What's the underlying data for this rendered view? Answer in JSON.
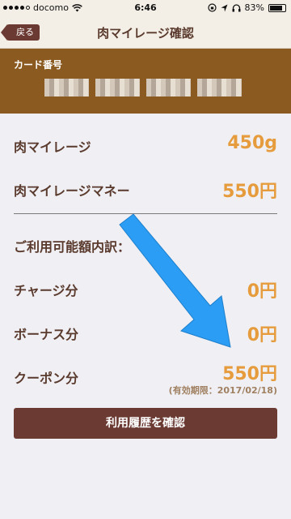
{
  "status_bar": {
    "carrier": "docomo",
    "time": "6:46",
    "battery": "83%",
    "battery_level": 0.83,
    "signal_bars": 4,
    "signal_total": 5
  },
  "nav": {
    "back_label": "戻る",
    "title": "肉マイレージ確認"
  },
  "card": {
    "label": "カード番号",
    "number_blocks": 4
  },
  "summary": [
    {
      "label": "肉マイレージ",
      "value": "450g"
    },
    {
      "label": "肉マイレージマネー",
      "value": "550円"
    }
  ],
  "breakdown": {
    "heading": "ご利用可能額内訳：",
    "items": [
      {
        "label": "チャージ分",
        "value": "0円"
      },
      {
        "label": "ボーナス分",
        "value": "0円"
      },
      {
        "label": "クーポン分",
        "value": "550円"
      }
    ],
    "expiry_note": "(有効期限：2017/02/18)"
  },
  "history_button_label": "利用履歴を確認",
  "colors": {
    "accent_value": "#e69c3c",
    "brown_button": "#6b3a33",
    "card_panel": "#8b5a20",
    "annotation_arrow": "#2b9df4"
  }
}
